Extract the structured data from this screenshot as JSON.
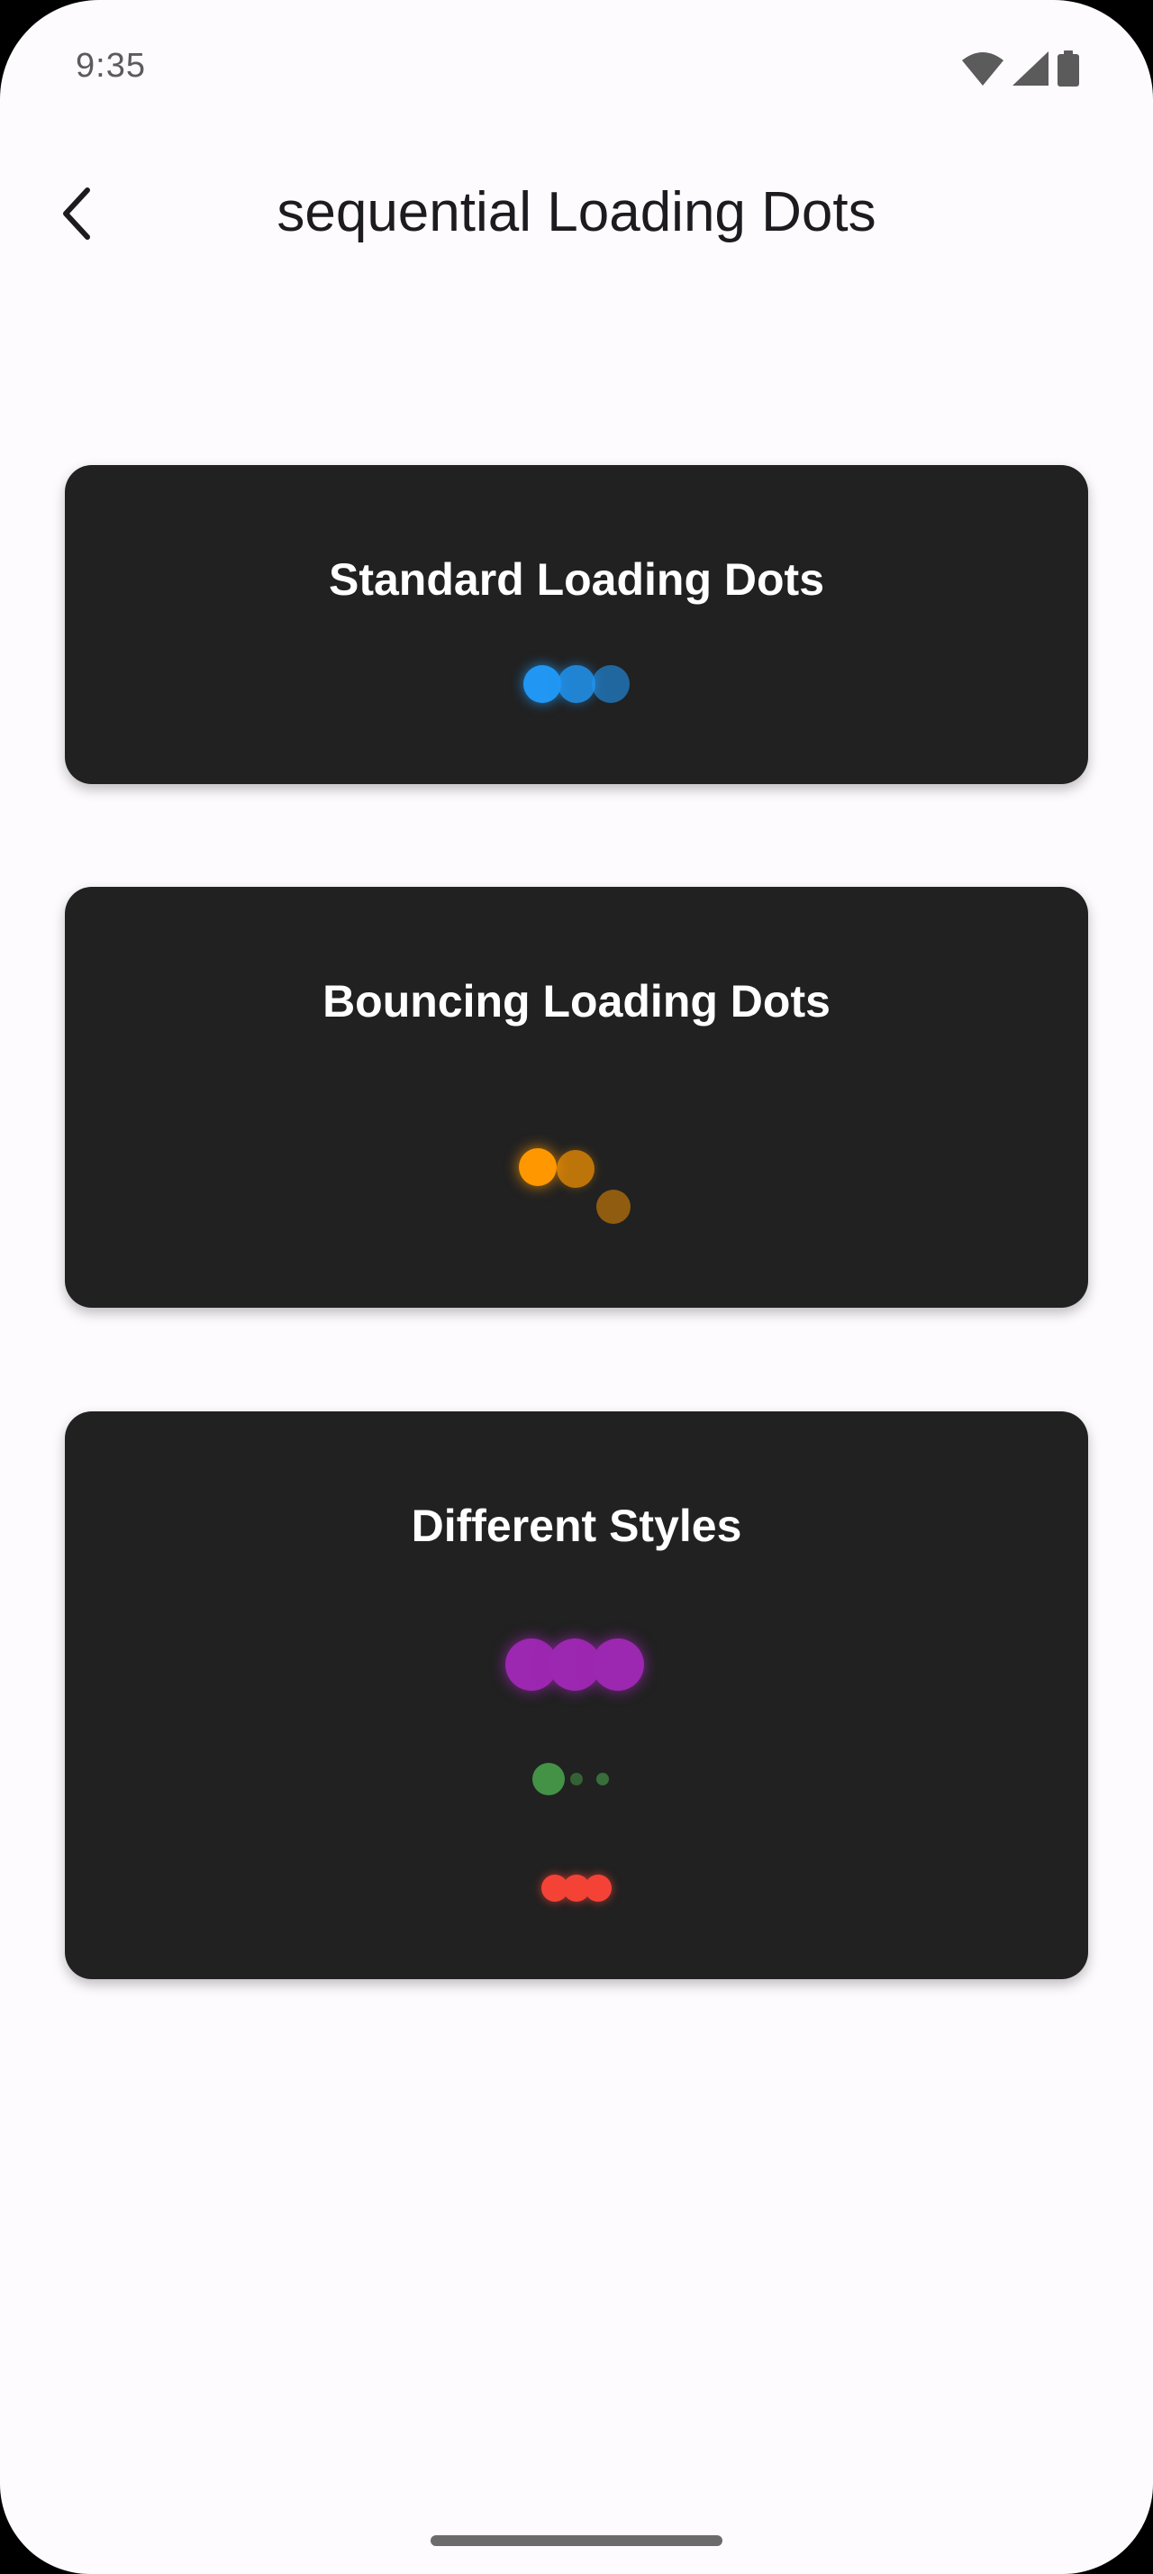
{
  "status_bar": {
    "time": "9:35",
    "icons": [
      "wifi-icon",
      "cellular-signal-icon",
      "battery-icon"
    ]
  },
  "app_bar": {
    "back_icon": "chevron-left-icon",
    "title": "sequential Loading Dots"
  },
  "cards": [
    {
      "title": "Standard Loading Dots",
      "dot_color": "#2196f3"
    },
    {
      "title": "Bouncing Loading Dots",
      "dot_color": "#ff9800"
    },
    {
      "title": "Different Styles",
      "dot_colors": [
        "#9c27b0",
        "#4caf50",
        "#f44336"
      ]
    }
  ],
  "colors": {
    "card_background": "#212121",
    "page_background": "#fefbff",
    "title_text": "#1c1b1f"
  }
}
